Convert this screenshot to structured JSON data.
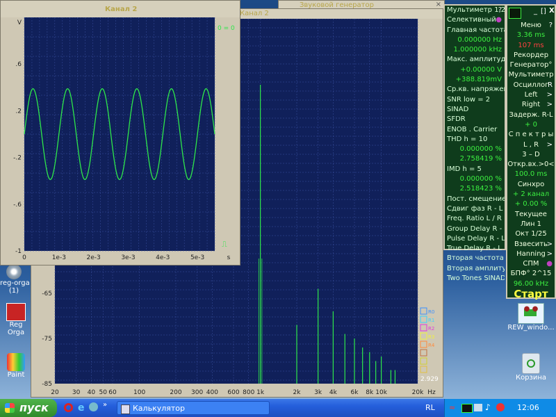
{
  "colors": {
    "trace": "#2ee84a",
    "plot_bg": "#10205a",
    "grid": "#3a4fa0",
    "title_text": "#b8a64a"
  },
  "desktop": {
    "icons": [
      {
        "label": "reg-orga\n(1)",
        "icon": "disc-icon"
      },
      {
        "label": "Reg Orga",
        "icon": "registry-icon"
      },
      {
        "label": "Paint",
        "icon": "paint-icon"
      },
      {
        "label": "REW_windo...",
        "icon": "installer-icon"
      },
      {
        "label": "Корзина",
        "icon": "recycle-bin-icon"
      }
    ]
  },
  "spectrum_window": {
    "title": "Канал 2",
    "yticks": [
      "-65",
      "-75",
      "-85"
    ],
    "xticks": [
      "20",
      "30",
      "40",
      "50",
      "60",
      "100",
      "200",
      "300",
      "400",
      "600",
      "800",
      "1k",
      "2k",
      "3k",
      "4k",
      "6k",
      "8k",
      "10k",
      "20k"
    ],
    "xunit": "Hz",
    "readout": "2.929",
    "legend": [
      "R0",
      "R1",
      "R2",
      "R3",
      "R4",
      "",
      "",
      ""
    ]
  },
  "scope_window": {
    "title": "Канал 2",
    "yunit": "V",
    "yticks": [
      ".6",
      ".2",
      "-.2",
      "-.6",
      "-1"
    ],
    "xticks": [
      "0",
      "1e-3",
      "2e-3",
      "3e-3",
      "4e-3",
      "5e-3"
    ],
    "xunit": "s",
    "cursor_text": "0 = 0"
  },
  "bg_window": {
    "title": "Звуковой генератор"
  },
  "multimeter": {
    "rows": [
      {
        "t": "Мультиметр 1,2",
        "q": "?"
      },
      {
        "t": "Селективный",
        "q": "●"
      },
      {
        "t": "Главная частота"
      },
      {
        "v": "0.000000  Hz"
      },
      {
        "v": "1.000000 kHz"
      },
      {
        "t": "Макс. амплитуда"
      },
      {
        "v": "+0.00000  V"
      },
      {
        "v": "+388.819mV"
      },
      {
        "t": "Ср.кв. напряжение"
      },
      {
        "t": "SNR      low =   2"
      },
      {
        "t": "SINAD"
      },
      {
        "t": "SFDR"
      },
      {
        "t": "ENOB . Carrier"
      },
      {
        "t": "THD      h =   10"
      },
      {
        "v": "0.000000 %"
      },
      {
        "v": "2.758419 %"
      },
      {
        "t": "IMD      h =    5"
      },
      {
        "v": "0.000000 %"
      },
      {
        "v": "2.518423 %"
      },
      {
        "t": "Пост. смещение"
      },
      {
        "t": "Сдвиг фаз R - L"
      },
      {
        "t": "Freq. Ratio  L / R"
      },
      {
        "t": "Group Delay R - L"
      },
      {
        "t": "Pulse Delay R - L"
      },
      {
        "t": "True Delay R - L"
      },
      {
        "t": "Вторая частота"
      },
      {
        "t": "Вторая амплитуда"
      },
      {
        "t": "Two Tones SINAD"
      }
    ]
  },
  "control_panel": {
    "window_buttons": [
      "_",
      "[]",
      "X"
    ],
    "rows": [
      {
        "t": "Меню",
        "a": "?"
      },
      {
        "t": "3.36 ms",
        "c": "grn"
      },
      {
        "t": "107  ms",
        "c": "red"
      },
      {
        "t": "Рекордер"
      },
      {
        "t": "Генератор°"
      },
      {
        "t": "Мультиметр"
      },
      {
        "t": "Осциллог",
        "a": "R"
      },
      {
        "t": "Left",
        "a": ">"
      },
      {
        "t": "Right",
        "a": ">"
      },
      {
        "t": "Задерж. R-L"
      },
      {
        "t": "+       0",
        "c": "grn"
      },
      {
        "t": "С п е к т р ы"
      },
      {
        "t": "L , R",
        "a": ">"
      },
      {
        "t": "3 – D"
      },
      {
        "t": "Откр.вх.>0<"
      },
      {
        "t": "100.0 ms",
        "c": "grn"
      },
      {
        "t": "Синхро"
      },
      {
        "t": "+  2 канал",
        "c": "grn"
      },
      {
        "t": "+  0.00 %",
        "c": "grn"
      },
      {
        "t": "Текущее"
      },
      {
        "t": "Лин       1"
      },
      {
        "t": "Окт   1/25"
      },
      {
        "t": "Взвесить",
        "a": ">"
      },
      {
        "t": "Hanning",
        "a": ">"
      },
      {
        "t": "СПМ",
        "a": "●"
      },
      {
        "t": "БПФ° 2^15"
      },
      {
        "t": "96.00 kHz",
        "c": "grn"
      },
      {
        "t": "Старт",
        "c": "start"
      },
      {
        "t": "●       ●"
      }
    ]
  },
  "taskbar": {
    "start_label": "пуск",
    "task_label": "Калькулятор",
    "lang": "RL",
    "clock": "12:06"
  }
}
